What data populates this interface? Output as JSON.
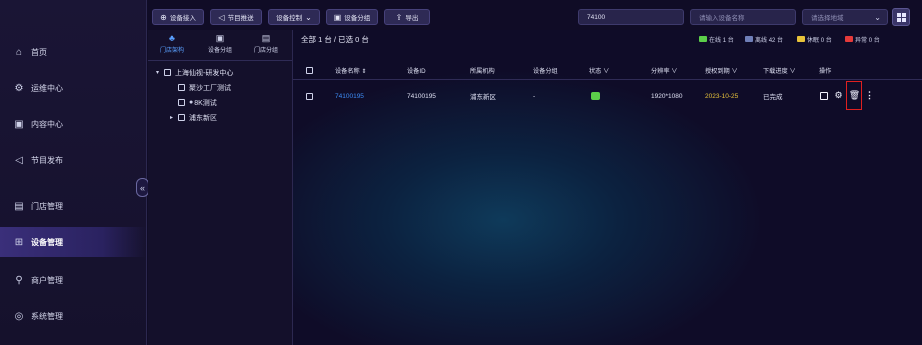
{
  "sidebar": {
    "items": [
      {
        "label": "首页",
        "icon": "home-icon",
        "glyph": "⌂"
      },
      {
        "label": "运维中心",
        "icon": "ops-icon",
        "glyph": "⚙"
      },
      {
        "label": "内容中心",
        "icon": "content-icon",
        "glyph": "▣"
      },
      {
        "label": "节目发布",
        "icon": "send-icon",
        "glyph": "◁"
      },
      {
        "label": "门店管理",
        "icon": "store-icon",
        "glyph": "▤"
      },
      {
        "label": "设备管理",
        "icon": "device-icon",
        "glyph": "⊞"
      },
      {
        "label": "商户管理",
        "icon": "merchant-icon",
        "glyph": "⚲"
      },
      {
        "label": "系统管理",
        "icon": "system-icon",
        "glyph": "◎"
      }
    ],
    "collapse_glyph": "«"
  },
  "toolbar": {
    "add_device": "设备接入",
    "publish": "节目推送",
    "device_control": "设备控制",
    "device_group": "设备分组",
    "export": "导出",
    "search_value": "74100",
    "device_name_placeholder": "请输入设备名称",
    "region_placeholder": "请选择地域"
  },
  "tree": {
    "tabs": [
      {
        "label": "门店架构",
        "glyph": "♣"
      },
      {
        "label": "设备分组",
        "glyph": "▣"
      },
      {
        "label": "门店分组",
        "glyph": "▤"
      }
    ],
    "root": "上海仙视-研发中心",
    "children": [
      "聚沙工厂测试",
      "8K测试",
      "浦东新区"
    ]
  },
  "main": {
    "summary": "全部 1 台 / 已选 0 台",
    "legend": [
      {
        "label": "在线",
        "count": "1 台",
        "color": "#5ccf4a"
      },
      {
        "label": "离线",
        "count": "42 台",
        "color": "#6f7fb8"
      },
      {
        "label": "休眠",
        "count": "0 台",
        "color": "#e8c33a"
      },
      {
        "label": "异常",
        "count": "0 台",
        "color": "#e53a3a"
      }
    ],
    "columns": [
      "设备名称 ⇕",
      "设备ID",
      "所属机构",
      "设备分组",
      "状态 ∨",
      "分辨率 ∨",
      "授权到期 ∨",
      "下载进度 ∨",
      "操作"
    ],
    "rows": [
      {
        "name": "74100195",
        "id": "74100195",
        "org": "浦东新区",
        "group": "-",
        "status": "online",
        "resolution": "1920*1080",
        "expiry": "2023-10-25",
        "progress": "已完成"
      }
    ]
  }
}
